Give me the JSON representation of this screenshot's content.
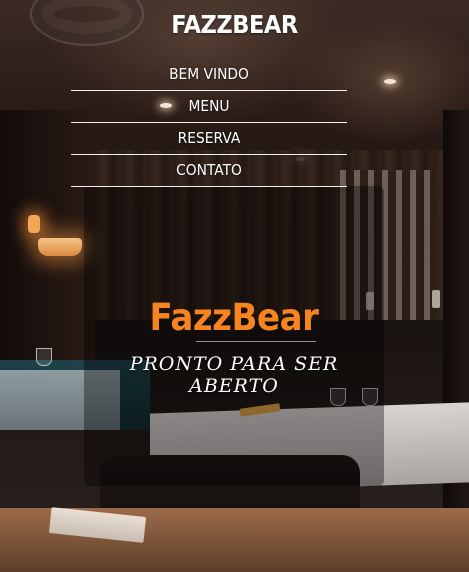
{
  "header": {
    "title": "FAZZBEAR"
  },
  "nav": {
    "items": [
      {
        "label": "BEM VINDO"
      },
      {
        "label": "MENU"
      },
      {
        "label": "RESERVA"
      },
      {
        "label": "CONTATO"
      }
    ]
  },
  "hero": {
    "brand": "FazzBear",
    "tagline": "PRONTO PARA SER ABERTO"
  },
  "colors": {
    "brand_accent": "#f7841f",
    "text": "#ffffff",
    "nav_divider": "#f0f0f0"
  },
  "background": {
    "image": "restaurant-interior-photo"
  }
}
